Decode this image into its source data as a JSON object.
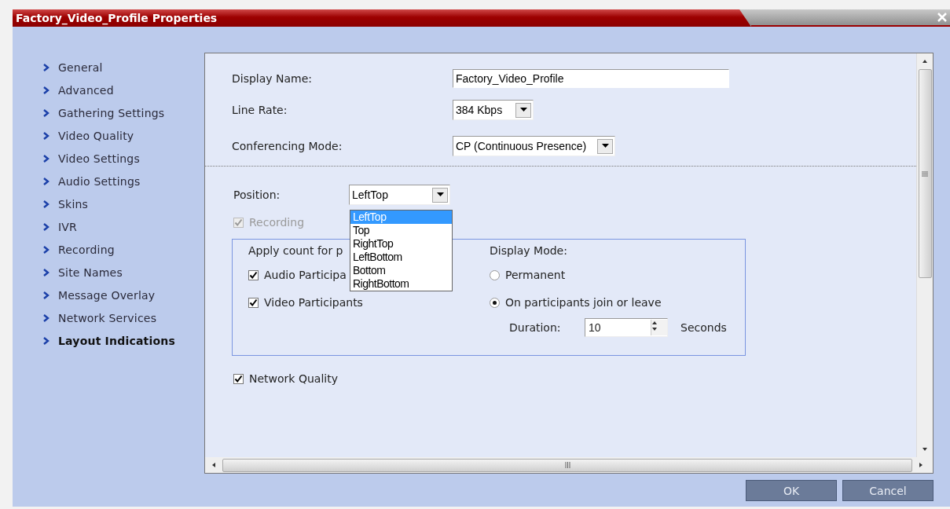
{
  "window": {
    "title": "Factory_Video_Profile Properties"
  },
  "sidebar": {
    "items": [
      {
        "label": "General",
        "selected": false
      },
      {
        "label": "Advanced",
        "selected": false
      },
      {
        "label": "Gathering Settings",
        "selected": false
      },
      {
        "label": "Video Quality",
        "selected": false
      },
      {
        "label": "Video Settings",
        "selected": false
      },
      {
        "label": "Audio Settings",
        "selected": false
      },
      {
        "label": "Skins",
        "selected": false
      },
      {
        "label": "IVR",
        "selected": false
      },
      {
        "label": "Recording",
        "selected": false
      },
      {
        "label": "Site Names",
        "selected": false
      },
      {
        "label": "Message Overlay",
        "selected": false
      },
      {
        "label": "Network Services",
        "selected": false
      },
      {
        "label": "Layout Indications",
        "selected": true
      }
    ]
  },
  "fields": [
    {
      "kind": "text",
      "label": "Display Name:",
      "value": "Factory_Video_Profile"
    },
    {
      "kind": "select",
      "label": "Line Rate:",
      "value": "384 Kbps"
    },
    {
      "kind": "select",
      "label": "Conferencing Mode:",
      "value": "CP (Continuous Presence)"
    }
  ],
  "position": {
    "label": "Position:",
    "value": "LeftTop",
    "options": [
      {
        "label": "LeftTop",
        "selected": true
      },
      {
        "label": "Top",
        "selected": false
      },
      {
        "label": "RightTop",
        "selected": false
      },
      {
        "label": "LeftBottom",
        "selected": false
      },
      {
        "label": "Bottom",
        "selected": false
      },
      {
        "label": "RightBottom",
        "selected": false
      }
    ]
  },
  "recording": {
    "label": "Recording",
    "checked": true,
    "disabled": true
  },
  "group": {
    "apply_label": "Apply count for p",
    "participants": [
      {
        "label": "Audio Participa",
        "checked": true
      },
      {
        "label": "Video Participants",
        "checked": true
      }
    ],
    "display_mode": {
      "label": "Display Mode:",
      "options": [
        {
          "label": "Permanent",
          "selected": false
        },
        {
          "label": "On participants join or leave",
          "selected": true
        }
      ]
    },
    "duration": {
      "label": "Duration:",
      "value": "10",
      "unit": "Seconds"
    }
  },
  "network_quality": {
    "label": "Network Quality",
    "checked": true
  },
  "buttons": [
    {
      "label": "OK"
    },
    {
      "label": "Cancel"
    }
  ]
}
